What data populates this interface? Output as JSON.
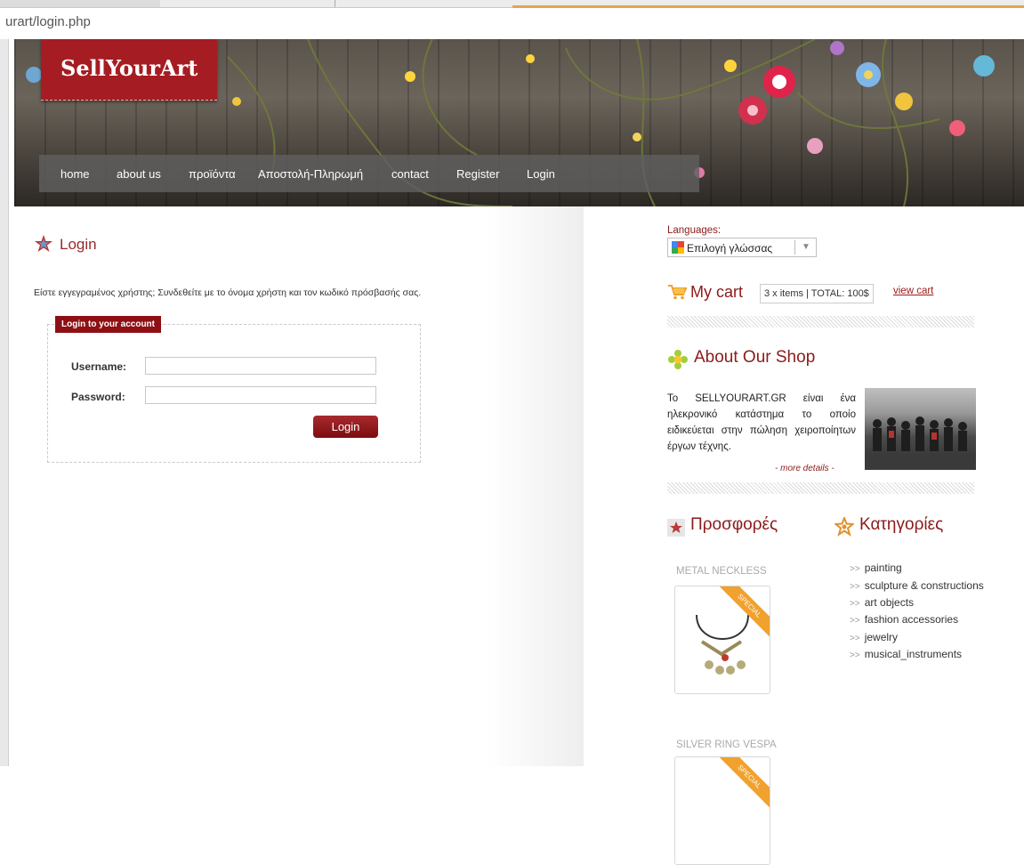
{
  "browser": {
    "url": "urart/login.php"
  },
  "header": {
    "logo": "SellYourArt",
    "nav": [
      "home",
      "about us",
      "προϊόντα",
      "Αποστολή-Πληρωμή",
      "contact",
      "Register",
      "Login"
    ]
  },
  "login": {
    "title": "Login",
    "intro": "Είστε εγγεγραμένος χρήστης; Συνδεθείτε με το όνομα χρήστη και τον κωδικό πρόσβασής σας.",
    "legend": "Login to your account",
    "username_label": "Username:",
    "password_label": "Password:",
    "username_value": "",
    "password_value": "",
    "button": "Login"
  },
  "sidebar": {
    "languages_label": "Languages:",
    "language_select": "Επιλογή γλώσσας",
    "cart": {
      "title": "My cart",
      "summary": "3 x items | TOTAL: 100$",
      "view_link": "view cart"
    },
    "about": {
      "title": "About Our Shop",
      "text": "Το SELLYOURART.GR είναι ένα ηλεκρονικό κατάστημα το οποίο ειδικεύεται στην πώληση χειροποίητων έργων τέχνης.",
      "more": "- more details -"
    },
    "offers": {
      "title": "Προσφορές",
      "products": [
        {
          "name": "METAL NECKLESS",
          "badge": "SPECIAL"
        },
        {
          "name": "SILVER RING VESPA",
          "badge": "SPECIAL"
        }
      ]
    },
    "categories": {
      "title": "Κατηγορίες",
      "items": [
        "painting",
        "sculpture & constructions",
        "art objects",
        "fashion accessories",
        "jewelry",
        "musical_instruments"
      ]
    }
  },
  "colors": {
    "brand_red": "#a51d22",
    "title_red": "#8c1a1a",
    "special_orange": "#f0a12e"
  }
}
